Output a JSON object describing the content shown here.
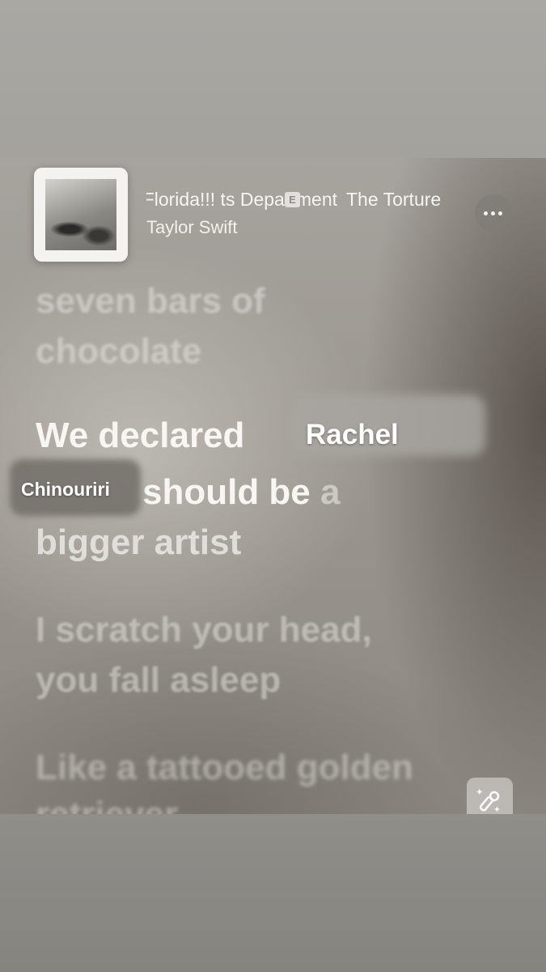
{
  "now_playing": {
    "song_title": "Florida!!! ts Department",
    "explicit_badge": "E",
    "album_title": "The Torture",
    "artist": "Taylor Swift"
  },
  "lyrics": {
    "past_line": [
      "seven bars of",
      "chocolate"
    ],
    "active_line_part1": "We declared",
    "active_line_part2": "should be",
    "active_line_part3": "a",
    "next_line_end": "bigger artist",
    "upcoming": [
      "I scratch your head,",
      "you fall asleep"
    ],
    "far_upcoming": [
      "Like a tattooed golden",
      "retriever"
    ]
  },
  "stickers": {
    "name_overlay_1": "Rachel",
    "name_overlay_2": "Chinouriri"
  },
  "icons": {
    "more": "ellipsis-icon",
    "sing": "microphone-sparkle-icon"
  },
  "colors": {
    "screen_background": "#9c9791",
    "outer_background": "#a6a5a0",
    "lyric_active": "#f7f6f3"
  }
}
